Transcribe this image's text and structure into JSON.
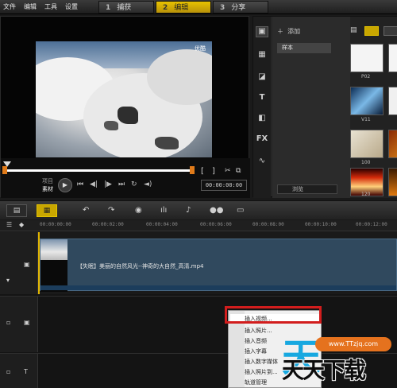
{
  "menubar": {
    "items": [
      "文件",
      "编辑",
      "工具",
      "设置"
    ],
    "steps": [
      {
        "num": "1",
        "label": "捕获"
      },
      {
        "num": "2",
        "label": "编辑"
      },
      {
        "num": "3",
        "label": "分享"
      }
    ]
  },
  "preview": {
    "watermark": "优酷",
    "mode_project": "项目",
    "mode_clip": "素材",
    "timecode": "00:00:00:00",
    "bracket_in": "[",
    "bracket_out": "]"
  },
  "library": {
    "add_label": "添加",
    "folder_sample": "样本",
    "browse_label": "浏览",
    "thumbs": [
      "P02",
      "V11",
      "100",
      "120"
    ],
    "sidebar_icons": [
      "media-icon",
      "instant-project-icon",
      "transition-icon",
      "title-icon",
      "graphic-icon",
      "filter-icon",
      "path-icon"
    ]
  },
  "ruler": {
    "ticks": [
      "00:00:00:00",
      "00:00:02:00",
      "00:00:04:00",
      "00:00:06:00",
      "00:00:08:00",
      "00:00:10:00",
      "00:00:12:00"
    ]
  },
  "timeline": {
    "clip_name": "【失眠】美丽的自然风光--神奇的大自然_高清.mp4"
  },
  "context_menu": {
    "items": [
      "插入视频...",
      "插入照片...",
      "插入音频",
      "插入字幕",
      "插入数字媒体",
      "插入照片到...",
      "轨道管理"
    ]
  },
  "site_watermark": {
    "url": "www.TTzjq.com",
    "logo": "天天下载"
  },
  "colors": {
    "accent": "#e8c200",
    "clip": "#30495e",
    "highlight": "#d21d1d"
  }
}
